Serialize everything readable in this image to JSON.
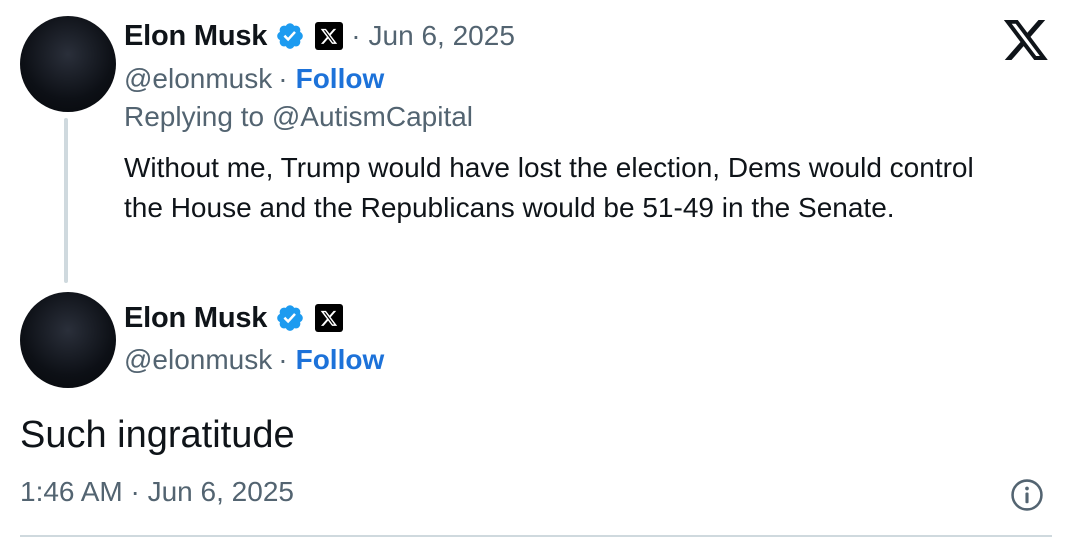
{
  "quoted_tweet": {
    "author_name": "Elon Musk",
    "handle": "@elonmusk",
    "follow_label": "Follow",
    "date_separator": "·",
    "date": "Jun 6, 2025",
    "replying_to": "Replying to @AutismCapital",
    "text": "Without me, Trump would have lost the election, Dems would control the House and the Republicans would be 51-49 in the Senate."
  },
  "main_tweet": {
    "author_name": "Elon Musk",
    "handle": "@elonmusk",
    "follow_label": "Follow",
    "text": "Such ingratitude",
    "timestamp": "1:46 AM · Jun 6, 2025"
  },
  "icons": {
    "verified": "verified-badge-icon",
    "affiliate": "x-affiliate-badge-icon",
    "logo": "x-logo-icon",
    "info": "info-icon"
  },
  "colors": {
    "verified": "#1d9bf0",
    "follow": "#1d72d9",
    "secondary_text": "#536471",
    "thread_line": "#cfd9de"
  }
}
